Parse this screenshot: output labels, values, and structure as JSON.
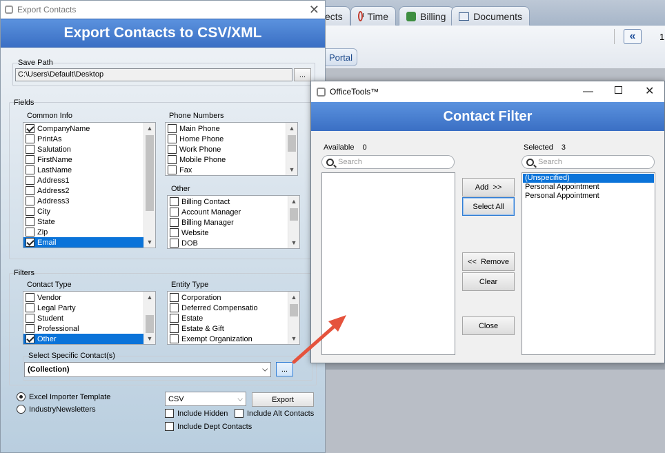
{
  "background": {
    "tabs": [
      {
        "label": "ects",
        "icon": "contacts-icon"
      },
      {
        "label": "Time",
        "icon": "clock-icon"
      },
      {
        "label": "Billing",
        "icon": "billing-icon"
      },
      {
        "label": "Documents",
        "icon": "documents-icon"
      }
    ],
    "collapse_label": "«",
    "page_number": "1",
    "portal_label": "Portal"
  },
  "export_dialog": {
    "window_title": "Export Contacts",
    "header": "Export Contacts to CSV/XML",
    "save_path": {
      "label": "Save Path",
      "value": "C:\\Users\\Default\\Desktop",
      "browse_label": "..."
    },
    "fields_label": "Fields",
    "common_info": {
      "label": "Common Info",
      "items": [
        {
          "label": "CompanyName",
          "checked": true,
          "selected": false
        },
        {
          "label": "PrintAs",
          "checked": false,
          "selected": false
        },
        {
          "label": "Salutation",
          "checked": false,
          "selected": false
        },
        {
          "label": "FirstName",
          "checked": false,
          "selected": false
        },
        {
          "label": "LastName",
          "checked": false,
          "selected": false
        },
        {
          "label": "Address1",
          "checked": false,
          "selected": false
        },
        {
          "label": "Address2",
          "checked": false,
          "selected": false
        },
        {
          "label": "Address3",
          "checked": false,
          "selected": false
        },
        {
          "label": "City",
          "checked": false,
          "selected": false
        },
        {
          "label": "State",
          "checked": false,
          "selected": false
        },
        {
          "label": "Zip",
          "checked": false,
          "selected": false
        },
        {
          "label": "Email",
          "checked": true,
          "selected": true
        }
      ]
    },
    "phone_numbers": {
      "label": "Phone Numbers",
      "items": [
        {
          "label": "Main Phone",
          "checked": false,
          "selected": false
        },
        {
          "label": "Home Phone",
          "checked": false,
          "selected": false
        },
        {
          "label": "Work Phone",
          "checked": false,
          "selected": false
        },
        {
          "label": "Mobile Phone",
          "checked": false,
          "selected": false
        },
        {
          "label": "Fax",
          "checked": false,
          "selected": false
        }
      ]
    },
    "other": {
      "label": "Other",
      "items": [
        {
          "label": "Billing Contact",
          "checked": false,
          "selected": false
        },
        {
          "label": "Account Manager",
          "checked": false,
          "selected": false
        },
        {
          "label": "Billing Manager",
          "checked": false,
          "selected": false
        },
        {
          "label": "Website",
          "checked": false,
          "selected": false
        },
        {
          "label": "DOB",
          "checked": false,
          "selected": false
        }
      ]
    },
    "filters_label": "Filters",
    "contact_type": {
      "label": "Contact Type",
      "items": [
        {
          "label": "Vendor",
          "checked": false,
          "selected": false
        },
        {
          "label": "Legal Party",
          "checked": false,
          "selected": false
        },
        {
          "label": "Student",
          "checked": false,
          "selected": false
        },
        {
          "label": "Professional",
          "checked": false,
          "selected": false
        },
        {
          "label": "Other",
          "checked": true,
          "selected": true
        }
      ]
    },
    "entity_type": {
      "label": "Entity Type",
      "items": [
        {
          "label": "Corporation",
          "checked": false,
          "selected": false
        },
        {
          "label": "Deferred Compensatio",
          "checked": false,
          "selected": false
        },
        {
          "label": "Estate",
          "checked": false,
          "selected": false
        },
        {
          "label": "Estate & Gift",
          "checked": false,
          "selected": false
        },
        {
          "label": "Exempt Organization",
          "checked": false,
          "selected": false
        }
      ]
    },
    "specific_contacts": {
      "label": "Select Specific Contact(s)",
      "value": "(Collection)",
      "browse_label": "..."
    },
    "template_options": [
      {
        "label": "Excel Importer Template",
        "selected": true
      },
      {
        "label": "IndustryNewsletters",
        "selected": false
      }
    ],
    "format": {
      "value": "CSV"
    },
    "export_label": "Export",
    "include_hidden": {
      "label": "Include Hidden",
      "checked": false
    },
    "include_alt": {
      "label": "Include Alt Contacts",
      "checked": false
    },
    "include_dept": {
      "label": "Include Dept Contacts",
      "checked": false
    }
  },
  "filter_dialog": {
    "window_title": "OfficeTools™",
    "header": "Contact Filter",
    "available": {
      "label": "Available",
      "count": "0",
      "search_placeholder": "Search",
      "items": []
    },
    "selected": {
      "label": "Selected",
      "count": "3",
      "search_placeholder": "Search",
      "items": [
        {
          "label": "(Unspecified)",
          "selected": true
        },
        {
          "label": "Personal Appointment",
          "selected": false
        },
        {
          "label": "Personal Appointment",
          "selected": false
        }
      ]
    },
    "buttons": {
      "add": "Add  >>",
      "select_all": "Select All",
      "remove": "<<  Remove",
      "clear": "Clear",
      "close": "Close"
    }
  },
  "colors": {
    "accent": "#3a6fc4",
    "selection": "#0a73d9",
    "arrow": "#e5533d"
  }
}
